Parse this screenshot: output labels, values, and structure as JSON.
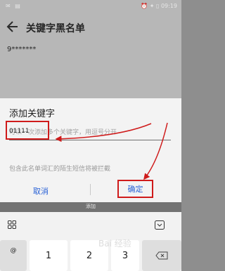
{
  "status_bar": {
    "left": "✉ ▤",
    "right": "⏰ ✦ ▯ 09:19"
  },
  "app": {
    "title": "关键字黑名单",
    "entry": "9*******"
  },
  "dialog": {
    "title": "添加关键字",
    "placeholder": "可以一次添加多个关键字，用逗号分开",
    "input_value": "01111",
    "description": "包含此名单词汇的陌生短信将被拦截",
    "cancel_label": "取消",
    "ok_label": "确定"
  },
  "keyboard": {
    "label": "添加",
    "keys": {
      "symbol": "@",
      "k1": "1",
      "k2": "2",
      "k3": "3"
    }
  },
  "watermark": "Bai 经验",
  "colors": {
    "accent": "#2a62d6",
    "annotation": "#cf1b1b"
  }
}
